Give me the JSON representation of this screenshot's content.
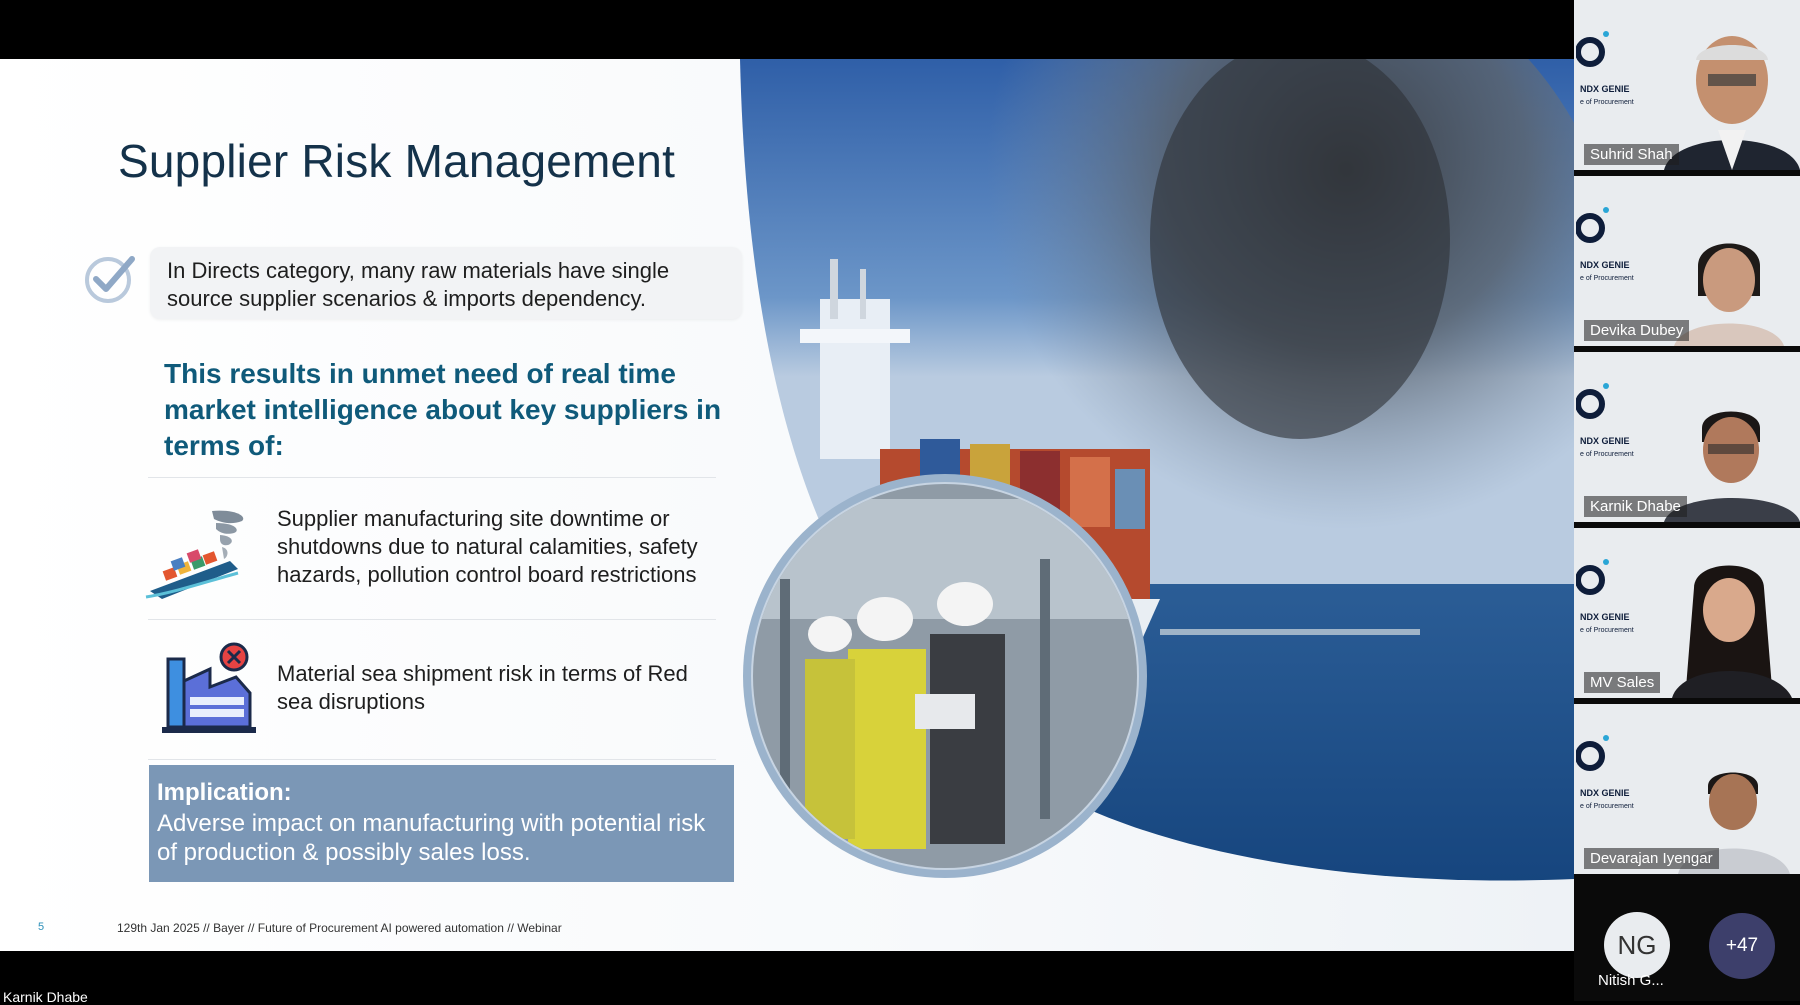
{
  "slide": {
    "title": "Supplier Risk Management",
    "intro_text": "In Directs category, many raw materials have single source supplier scenarios & imports dependency.",
    "headline": "This results in unmet need of real time market intelligence about key suppliers in terms of:",
    "points": [
      {
        "icon": "cyclone-ship-icon",
        "text": "Supplier manufacturing site downtime or shutdowns due to natural calamities, safety hazards, pollution control board restrictions"
      },
      {
        "icon": "factory-error-icon",
        "text": "Material sea shipment risk in terms of Red sea disruptions"
      }
    ],
    "implication_title": "Implication:",
    "implication_text": "Adverse impact on manufacturing with potential risk of production & possibly sales loss.",
    "page_number": "5",
    "footer": "129th Jan 2025 // Bayer // Future of Procurement AI powered automation // Webinar"
  },
  "participants": [
    {
      "name": "Suhrid Shah"
    },
    {
      "name": "Devika Dubey"
    },
    {
      "name": "Karnik Dhabe"
    },
    {
      "name": "MV Sales"
    },
    {
      "name": "Devarajan Iyengar"
    }
  ],
  "brand": {
    "line1": "NDX GENIE",
    "line2": "e of Procurement"
  },
  "extra_participant": {
    "initials": "NG",
    "name": "Nitish G..."
  },
  "more_count": "+47",
  "active_speaker": "Karnik Dhabe",
  "colors": {
    "title": "#14324a",
    "headline": "#0f5a7a",
    "implication_bg": "#7b97b6",
    "accent": "#2b8fb9"
  }
}
